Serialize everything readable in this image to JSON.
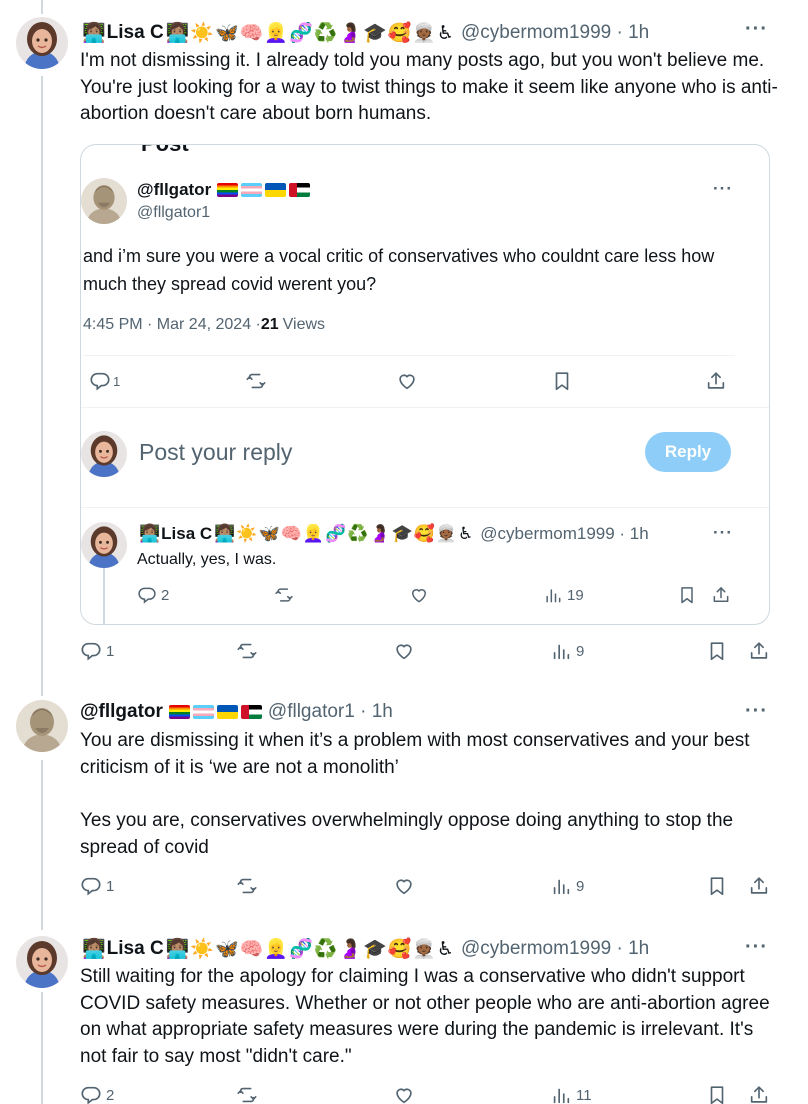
{
  "post1": {
    "name": "Lisa C",
    "emojis": "👩🏽‍💻☀️🦋🧠👱‍♀️🧬♻️🤰🏾🎓🥰👳🏾♿",
    "handle": "@cybermom1999 · 1h",
    "text": "I'm not dismissing it. I already told you many posts ago, but you won't believe me. You're just looking for a way to  twist things to make it seem like anyone who is anti-abortion doesn't care about born humans.",
    "replies": "1",
    "views": "9"
  },
  "quote": {
    "header_clip": "Post",
    "name": "@fllgator",
    "handle": "@fllgator1",
    "text": "and i’m sure you were a vocal critic of conservatives who couldnt care less how much they spread covid werent you?",
    "time": "4:45 PM · Mar 24, 2024 · ",
    "views_count": "21",
    "views_label": "Views",
    "replies": "1",
    "reply_placeholder": "Post your reply",
    "reply_button": "Reply",
    "nested": {
      "name": "Lisa C",
      "emojis": "👩🏽‍💻☀️🦋🧠👱‍♀️🧬♻️🤰🏾🎓🥰👳🏾♿",
      "handle": "@cybermom1999 · 1h",
      "text": "Actually, yes, I was.",
      "replies": "2",
      "views": "19"
    }
  },
  "post2": {
    "name": "@fllgator",
    "handle": "@fllgator1 · 1h",
    "text1": "You are dismissing it when it’s a problem with most conservatives and your best criticism of it is ‘we are not a monolith’",
    "text2": "Yes you are, conservatives overwhelmingly oppose doing anything to stop the spread of covid",
    "replies": "1",
    "views": "9"
  },
  "post3": {
    "name": "Lisa C",
    "emojis": "👩🏽‍💻☀️🦋🧠👱‍♀️🧬♻️🤰🏾🎓🥰👳🏾♿",
    "handle": "@cybermom1999 · 1h",
    "text": "Still waiting for the apology for claiming I was a conservative who didn't support COVID safety measures. Whether or not other people who are anti-abortion agree on what appropriate safety measures were during the pandemic is irrelevant. It's not fair to say most \"didn't care.\"",
    "replies": "2",
    "views": "11"
  },
  "icons": {
    "more": "more-icon",
    "reply": "reply-icon",
    "repost": "repost-icon",
    "like": "heart-icon",
    "views": "views-icon",
    "bookmark": "bookmark-icon",
    "share": "share-icon"
  },
  "colors": {
    "text": "#0f1419",
    "secondary": "#536471",
    "border": "#cfd9de",
    "reply_button": "#8ecdf8"
  }
}
